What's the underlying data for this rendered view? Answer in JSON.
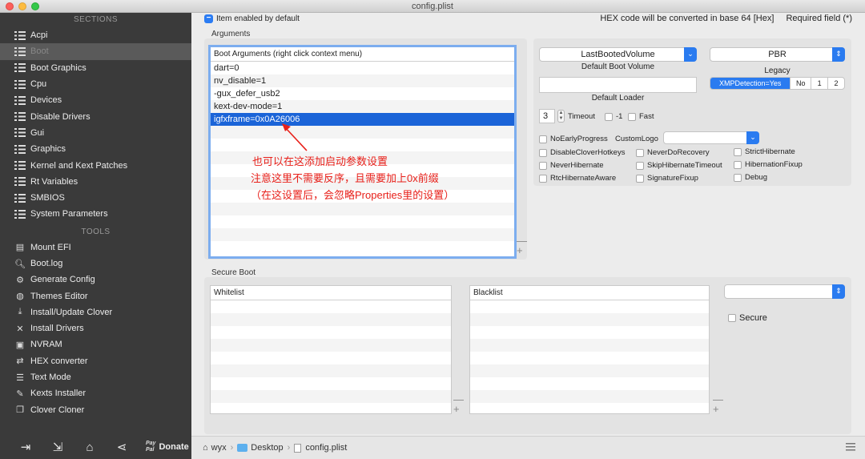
{
  "window": {
    "title": "config.plist"
  },
  "sidebar": {
    "sections_heading": "SECTIONS",
    "sections": [
      {
        "label": "Acpi",
        "icon": "list-icon"
      },
      {
        "label": "Boot",
        "icon": "list-icon",
        "selected": true
      },
      {
        "label": "Boot Graphics",
        "icon": "list-icon"
      },
      {
        "label": "Cpu",
        "icon": "list-icon"
      },
      {
        "label": "Devices",
        "icon": "list-icon"
      },
      {
        "label": "Disable Drivers",
        "icon": "list-icon"
      },
      {
        "label": "Gui",
        "icon": "list-icon"
      },
      {
        "label": "Graphics",
        "icon": "list-icon"
      },
      {
        "label": "Kernel and Kext Patches",
        "icon": "list-icon"
      },
      {
        "label": "Rt Variables",
        "icon": "list-icon"
      },
      {
        "label": "SMBIOS",
        "icon": "list-icon"
      },
      {
        "label": "System Parameters",
        "icon": "list-icon"
      }
    ],
    "tools_heading": "TOOLS",
    "tools": [
      {
        "label": "Mount EFI",
        "icon": "disk-icon"
      },
      {
        "label": "Boot.log",
        "icon": "log-search-icon"
      },
      {
        "label": "Generate Config",
        "icon": "gears-icon"
      },
      {
        "label": "Themes Editor",
        "icon": "palette-icon"
      },
      {
        "label": "Install/Update Clover",
        "icon": "download-icon"
      },
      {
        "label": "Install Drivers",
        "icon": "tools-icon"
      },
      {
        "label": "NVRAM",
        "icon": "chip-icon"
      },
      {
        "label": "HEX converter",
        "icon": "convert-icon"
      },
      {
        "label": "Text Mode",
        "icon": "text-mode-icon"
      },
      {
        "label": "Kexts Installer",
        "icon": "wrench-icon"
      },
      {
        "label": "Clover Cloner",
        "icon": "clone-icon"
      }
    ],
    "bottom": {
      "paypal_line1": "Pay",
      "paypal_line2": "Pal",
      "donate_label": "Donate"
    }
  },
  "main": {
    "item_enabled_label": "Item enabled by default",
    "hex_note": "HEX code will be converted in base 64 [Hex]",
    "required_note": "Required field (*)",
    "arguments_label": "Arguments",
    "boot_args_header": "Boot Arguments (right click context menu)",
    "boot_args": [
      "dart=0",
      "nv_disable=1",
      "-gux_defer_usb2",
      "kext-dev-mode=1",
      "igfxframe=0x0A26006",
      "",
      "",
      "",
      "",
      "",
      "",
      "",
      "",
      ""
    ],
    "annotation": {
      "line1": "也可以在这添加启动参数设置",
      "line2": "注意这里不需要反序，且需要加上0x前缀",
      "line3": "（在这设置后，会忽略Properties里的设置）"
    },
    "default_volume": "LastBootedVolume",
    "default_volume_label": "Default Boot Volume",
    "legacy_value": "PBR",
    "legacy_label": "Legacy",
    "default_loader_value": "",
    "default_loader_label": "Default Loader",
    "xmp": [
      "XMPDetection=Yes",
      "No",
      "1",
      "2"
    ],
    "timeout_value": "3",
    "timeout_label": "Timeout",
    "minus_one_label": "-1",
    "fast_label": "Fast",
    "no_early_progress": "NoEarlyProgress",
    "custom_logo": "CustomLogo",
    "flags_col1": [
      "DisableCloverHotkeys",
      "NeverHibernate",
      "RtcHibernateAware"
    ],
    "flags_col2": [
      "NeverDoRecovery",
      "SkipHibernateTimeout",
      "SignatureFixup"
    ],
    "flags_col3": [
      "StrictHibernate",
      "HibernationFixup",
      "Debug"
    ],
    "secure_boot_label": "Secure Boot",
    "whitelist_header": "Whitelist",
    "blacklist_header": "Blacklist",
    "secure_label": "Secure",
    "plus": "+",
    "minus": "—"
  },
  "pathbar": {
    "home": "wyx",
    "folder": "Desktop",
    "file": "config.plist"
  },
  "colors": {
    "accent": "#2a7bf0",
    "sidebar_bg": "#3a3a3a",
    "annotation": "#e8201a",
    "selection": "#1b64d8"
  }
}
